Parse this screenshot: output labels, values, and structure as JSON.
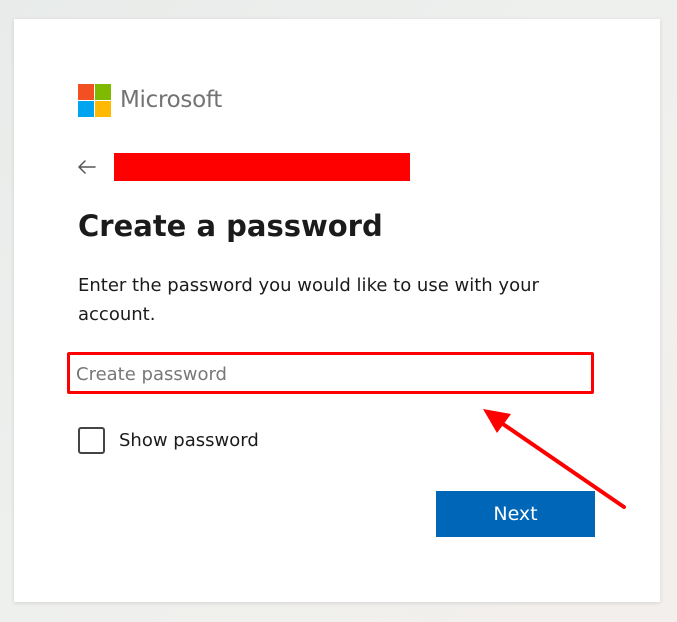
{
  "brand": {
    "name": "Microsoft",
    "logo_colors": [
      "#f25022",
      "#7fba00",
      "#00a4ef",
      "#ffb900"
    ]
  },
  "identity": {
    "back_icon": "arrow-left-icon",
    "redaction_color": "#ff0000"
  },
  "page": {
    "title": "Create a password",
    "description": "Enter the password you would like to use with your account."
  },
  "password_field": {
    "placeholder": "Create password",
    "value": "",
    "highlight_color": "#ff0000"
  },
  "show_password": {
    "label": "Show password",
    "checked": false
  },
  "actions": {
    "next_label": "Next",
    "accent": "#0067b8"
  },
  "annotation": {
    "arrow_color": "#ff0000"
  }
}
